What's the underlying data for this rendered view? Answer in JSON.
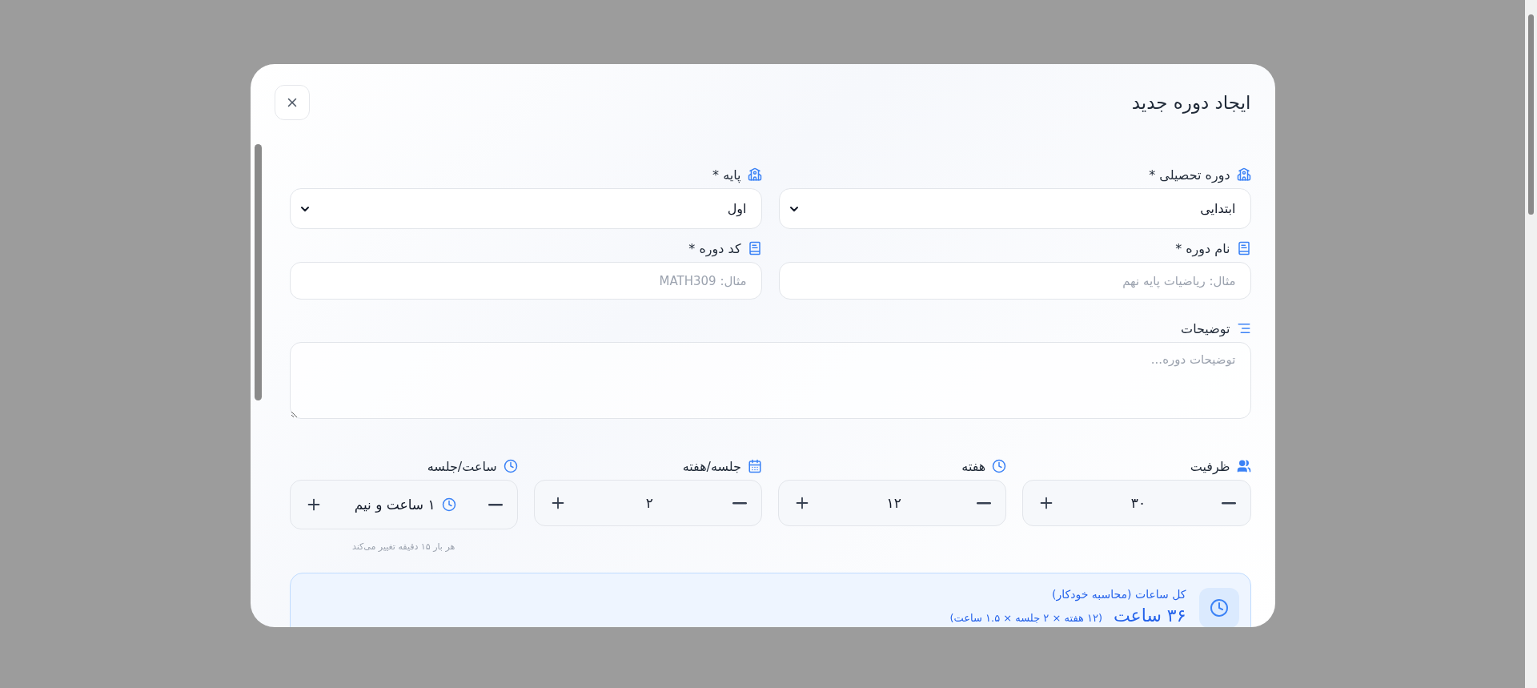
{
  "dialog": {
    "title": "ایجاد دوره جدید"
  },
  "fields": [
    {
      "kind": "select",
      "label": "دوره تحصیلی *",
      "value": "ابتدایی"
    },
    {
      "kind": "select",
      "label": "پایه *",
      "value": "اول"
    },
    {
      "kind": "text",
      "label": "نام دوره *",
      "placeholder": "مثال: ریاضیات پایه نهم"
    },
    {
      "kind": "text",
      "label": "کد دوره *",
      "placeholder": "مثال: MATH309"
    }
  ],
  "description": {
    "label": "توضیحات",
    "placeholder": "توضیحات دوره..."
  },
  "steppers": [
    {
      "label": "ظرفیت",
      "value": "۳۰"
    },
    {
      "label": "هفته",
      "value": "۱۲"
    },
    {
      "label": "جلسه/هفته",
      "value": "۲"
    },
    {
      "label": "ساعت/جلسه",
      "value": "۱ ساعت و نیم",
      "hint": "هر بار ۱۵ دقیقه تغییر می‌کند"
    }
  ],
  "summary": {
    "label": "کل ساعات (محاسبه خودکار)",
    "value": "۳۶ ساعت",
    "detail": "(۱۲ هفته × ۲ جلسه × ۱.۵ ساعت)"
  }
}
